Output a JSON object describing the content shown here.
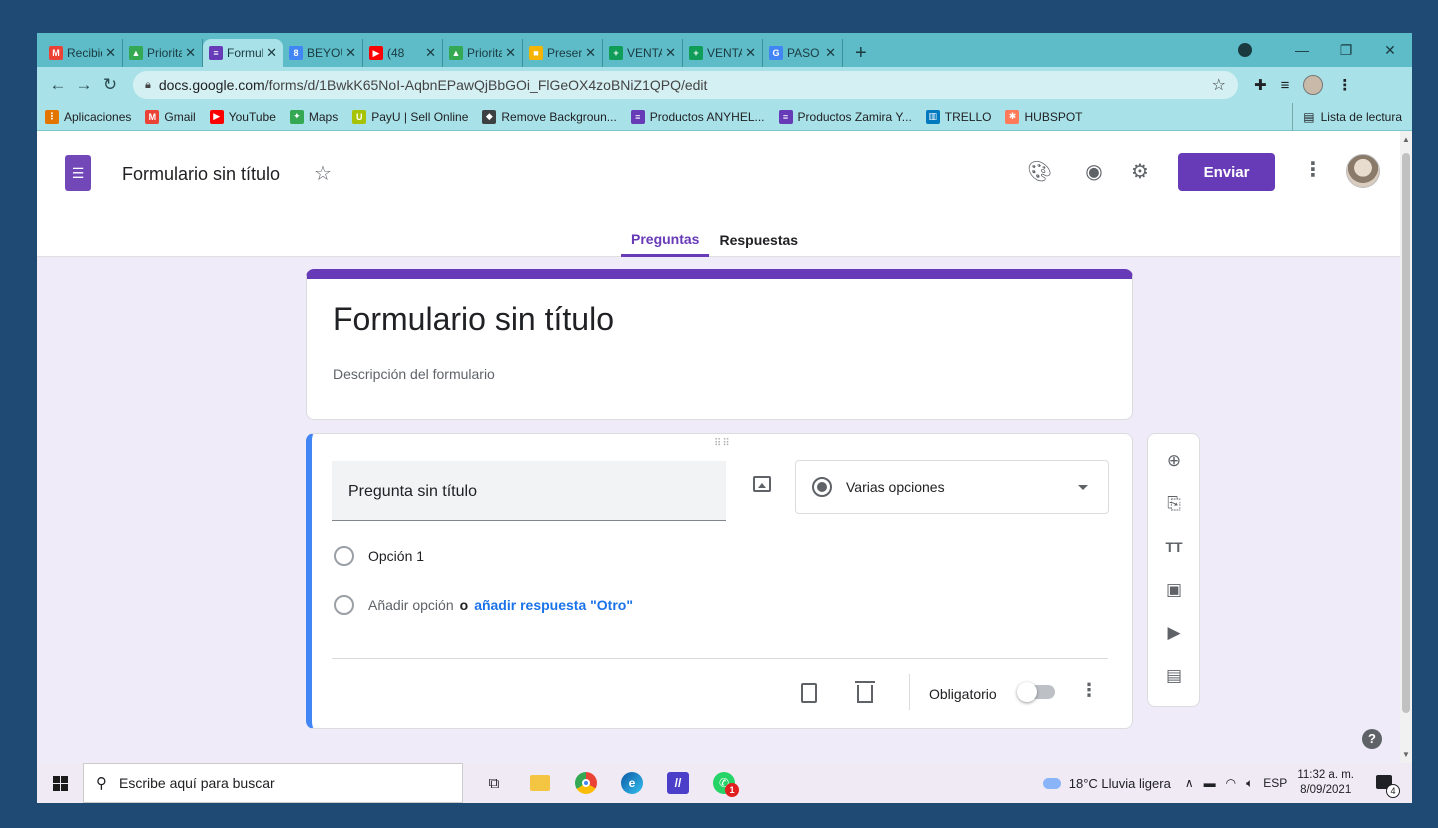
{
  "browser": {
    "tabs": [
      {
        "label": "Recibid",
        "favicon": "gmail-icon",
        "color": "#ea4335",
        "glyph": "M"
      },
      {
        "label": "Priorita",
        "favicon": "drive-icon",
        "color": "#34a853",
        "glyph": "▲"
      },
      {
        "label": "Formul",
        "favicon": "forms-icon",
        "color": "#673ab7",
        "glyph": "≡",
        "active": true
      },
      {
        "label": "BEYOU",
        "favicon": "calendar-icon",
        "color": "#4285f4",
        "glyph": "8"
      },
      {
        "label": "(48",
        "favicon": "youtube-icon",
        "color": "#ff0000",
        "glyph": "▶"
      },
      {
        "label": "Priorita",
        "favicon": "drive-icon",
        "color": "#34a853",
        "glyph": "▲"
      },
      {
        "label": "Presen",
        "favicon": "slides-icon",
        "color": "#f4b400",
        "glyph": "■"
      },
      {
        "label": "VENTA",
        "favicon": "sheets-icon",
        "color": "#0f9d58",
        "glyph": "+"
      },
      {
        "label": "VENTA",
        "favicon": "sheets-icon",
        "color": "#0f9d58",
        "glyph": "+"
      },
      {
        "label": "PASO /",
        "favicon": "google-icon",
        "color": "#4285f4",
        "glyph": "G"
      }
    ],
    "url_host": "docs.google.com",
    "url_path": "/forms/d/1BwkK65NoI-AqbnEPawQjBbGOi_FlGeOX4zoBNiZ1QPQ/edit",
    "bookmarks": [
      {
        "label": "Aplicaciones",
        "icon": "apps-grid-icon",
        "color": "#e37400",
        "glyph": "⋮"
      },
      {
        "label": "Gmail",
        "icon": "gmail-icon",
        "color": "#ea4335",
        "glyph": "M"
      },
      {
        "label": "YouTube",
        "icon": "youtube-icon",
        "color": "#ff0000",
        "glyph": "▶"
      },
      {
        "label": "Maps",
        "icon": "maps-icon",
        "color": "#34a853",
        "glyph": "✦"
      },
      {
        "label": "PayU | Sell Online",
        "icon": "payu-icon",
        "color": "#a6c307",
        "glyph": "U"
      },
      {
        "label": "Remove Backgroun...",
        "icon": "remove-bg-icon",
        "color": "#3c4043",
        "glyph": "◆"
      },
      {
        "label": "Productos ANYHEL...",
        "icon": "forms-icon",
        "color": "#673ab7",
        "glyph": "≡"
      },
      {
        "label": "Productos Zamira Y...",
        "icon": "forms-icon",
        "color": "#673ab7",
        "glyph": "≡"
      },
      {
        "label": "TRELLO",
        "icon": "trello-icon",
        "color": "#0079bf",
        "glyph": "▥"
      },
      {
        "label": "HUBSPOT",
        "icon": "hubspot-icon",
        "color": "#ff7a59",
        "glyph": "✱"
      }
    ],
    "reading_list": "Lista de lectura"
  },
  "forms": {
    "doc_title": "Formulario sin título",
    "send_label": "Enviar",
    "tabs": [
      "Preguntas",
      "Respuestas"
    ],
    "form_title": "Formulario sin título",
    "form_description": "Descripción del formulario",
    "question_title": "Pregunta sin título",
    "question_type": "Varias opciones",
    "option_1": "Opción 1",
    "add_option": "Añadir opción",
    "or_text": "o",
    "add_other": "añadir respuesta \"Otro\"",
    "required_label": "Obligatorio",
    "required": false,
    "accent_color": "#673ab7",
    "help_glyph": "?"
  },
  "taskbar": {
    "search_placeholder": "Escribe aquí para buscar",
    "weather": "18°C  Lluvia ligera",
    "lang": "ESP",
    "time": "11:32 a. m.",
    "date": "8/09/2021",
    "notifications": "4",
    "whatsapp_badge": "1"
  }
}
